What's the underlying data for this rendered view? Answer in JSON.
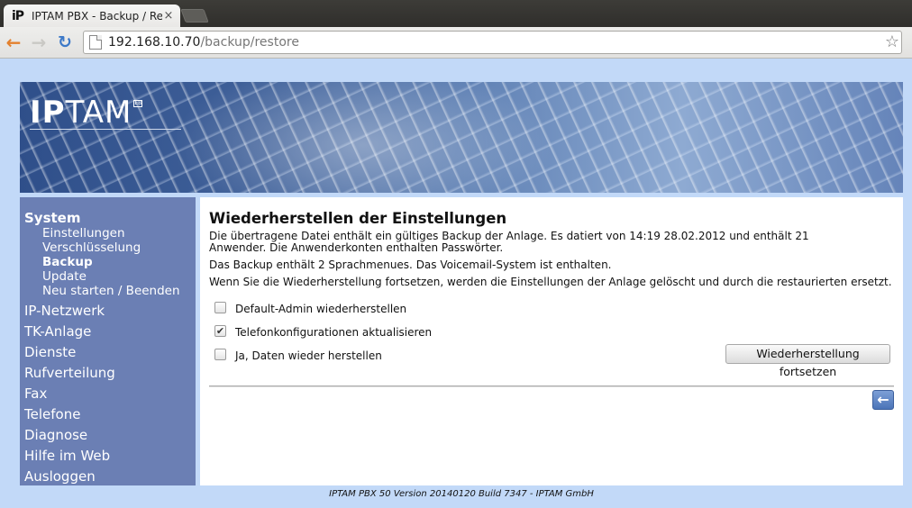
{
  "browser": {
    "tab_title": "IPTAM PBX - Backup / Res",
    "tab_close": "×",
    "favicon": "iP",
    "url_host": "192.168.10.70",
    "url_path": "/backup/restore",
    "icons": {
      "back": "back-arrow-icon",
      "forward": "forward-arrow-icon",
      "reload": "reload-icon",
      "bookmark": "star-icon"
    }
  },
  "banner": {
    "logo_text_bold": "IP",
    "logo_text": "TAM",
    "logo_mark": "EB"
  },
  "sidebar": {
    "section": "System",
    "sub_items": [
      {
        "label": "Einstellungen",
        "active": false
      },
      {
        "label": "Verschlüsselung",
        "active": false
      },
      {
        "label": "Backup",
        "active": true
      },
      {
        "label": "Update",
        "active": false
      },
      {
        "label": "Neu starten / Beenden",
        "active": false
      }
    ],
    "items": [
      {
        "label": "IP-Netzwerk"
      },
      {
        "label": "TK-Anlage"
      },
      {
        "label": "Dienste"
      },
      {
        "label": "Rufverteilung"
      },
      {
        "label": "Fax"
      },
      {
        "label": "Telefone"
      },
      {
        "label": "Diagnose"
      },
      {
        "label": "Hilfe im Web"
      },
      {
        "label": "Ausloggen"
      }
    ]
  },
  "content": {
    "title": "Wiederherstellen der Einstellungen",
    "text1": "Die übertragene Datei enthält ein gültiges Backup der Anlage. Es datiert von 14:19 28.02.2012 und enthält 21 Anwender. Die Anwenderkonten enthalten Passwörter.",
    "text2": "Das Backup enthält 2 Sprachmenues. Das Voicemail-System ist enthalten.",
    "text3": "Wenn Sie die Wiederherstellung fortsetzen, werden die Einstellungen der Anlage gelöscht und durch die restaurierten ersetzt.",
    "options": [
      {
        "label": "Default-Admin wiederherstellen",
        "checked": false
      },
      {
        "label": "Telefonkonfigurationen aktualisieren",
        "checked": true
      },
      {
        "label": "Ja, Daten wieder herstellen",
        "checked": false
      }
    ],
    "continue_button": "Wiederherstellung fortsetzen",
    "back_icon": "back-arrow-icon"
  },
  "footer": {
    "text": "IPTAM PBX 50 Version 20140120 Build 7347 - IPTAM GmbH"
  },
  "colors": {
    "page_background": "#c2d9f8",
    "sidebar": "#6b7fb4",
    "content_background": "#ffffff"
  }
}
